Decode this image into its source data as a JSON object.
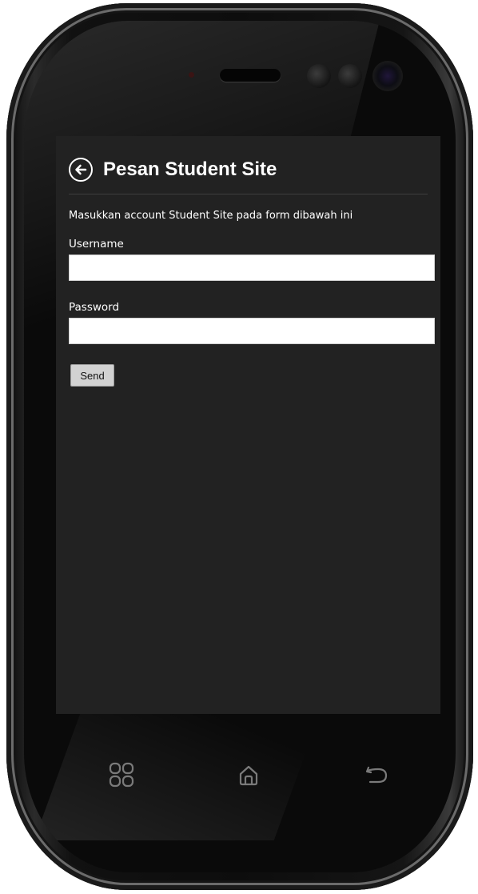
{
  "app": {
    "title": "Pesan Student Site"
  },
  "form": {
    "instruction": "Masukkan account Student Site pada form dibawah ini",
    "username_label": "Username",
    "username_value": "",
    "password_label": "Password",
    "password_value": "",
    "send_label": "Send"
  },
  "icons": {
    "back": "arrow-left-circle-icon",
    "menu": "grid-menu-icon",
    "home": "home-icon",
    "return": "return-arrow-icon"
  },
  "colors": {
    "screen_bg": "#222222",
    "text": "#ffffff",
    "field_bg": "#ffffff",
    "button_bg": "#d2d2d2"
  }
}
